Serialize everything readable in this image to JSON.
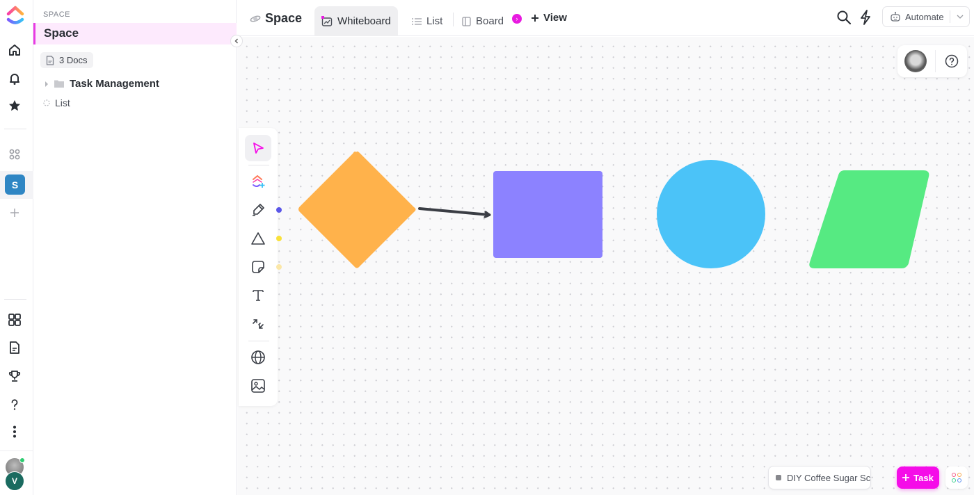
{
  "rail": {
    "space_initial": "S",
    "user_initial": "V",
    "top_icons": [
      "home-icon",
      "bell-icon",
      "star-icon"
    ],
    "bottom_icons": [
      "dashboards-icon",
      "docs-icon",
      "trophy-icon",
      "help-icon",
      "more-icon"
    ]
  },
  "sidebar": {
    "section_label": "SPACE",
    "space_name": "Space",
    "docs_chip": "3 Docs",
    "tree": [
      {
        "label": "Task Management",
        "type": "folder"
      },
      {
        "label": "List",
        "type": "list"
      }
    ]
  },
  "header": {
    "title": "Space",
    "tabs": [
      {
        "label": "Whiteboard",
        "active": true
      },
      {
        "label": "List",
        "active": false
      },
      {
        "label": "Board",
        "active": false
      }
    ],
    "add_view": "View",
    "automate": "Automate"
  },
  "canvas": {
    "shapes": [
      {
        "type": "diamond",
        "color": "#FFB24B"
      },
      {
        "type": "arrow",
        "color": "#3A3D44",
        "from": "diamond",
        "to": "rectangle"
      },
      {
        "type": "rectangle",
        "color": "#8C82FF"
      },
      {
        "type": "circle",
        "color": "#4BC3F8"
      },
      {
        "type": "parallelogram",
        "color": "#56EA82"
      }
    ],
    "tool_swatches": [
      "#5B57E8",
      "#F9E13A",
      "#FBE7A8"
    ],
    "tools": [
      "select",
      "clickup-ai",
      "pen",
      "shape",
      "sticky-note",
      "text",
      "connector",
      "embed-web",
      "image"
    ]
  },
  "bottom": {
    "task_chip": "DIY Coffee Sugar Scrub",
    "task_button": "Task"
  },
  "colors": {
    "accent": "#F50CE8",
    "space_badge": "#2F86C4",
    "user_avatar": "#1B6B60"
  }
}
